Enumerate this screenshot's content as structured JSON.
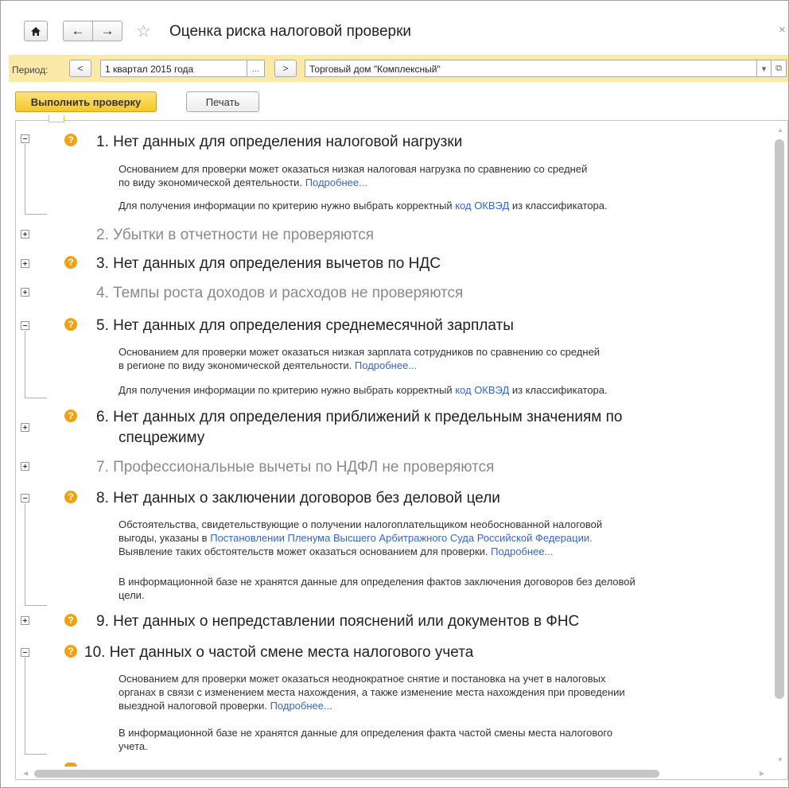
{
  "window": {
    "title": "Оценка риска налоговой проверки",
    "home_icon": "home-icon",
    "back_icon": "arrow-left-icon",
    "forward_icon": "arrow-right-icon",
    "favorite_icon": "star-icon",
    "close_icon": "close-icon",
    "close_glyph": "×"
  },
  "period_bar": {
    "label": "Период:",
    "prev": "<",
    "period_value": "1 квартал 2015 года",
    "ellipsis": "...",
    "next": ">",
    "organization": "Торговый дом \"Комплексный\"",
    "dropdown": "▾",
    "open_icon": "open-link-icon",
    "open_glyph": "⧉",
    "background": "#fbeaa7"
  },
  "actions": {
    "run_check": "Выполнить проверку",
    "print": "Печать",
    "accent": "#f4c829"
  },
  "items": {
    "i1": {
      "heading": "1. Нет данных для определения налоговой нагрузки",
      "d1": "Основанием для проверки может оказаться низкая налоговая нагрузка по сравнению со средней",
      "d2": "по виду экономической деятельности.",
      "more": "Подробнее...",
      "hint_pre": "Для получения информации по критерию нужно выбрать корректный",
      "hint_link": "код ОКВЭД",
      "hint_post": "из классификатора."
    },
    "i2": {
      "heading": "2. Убытки в отчетности не проверяются"
    },
    "i3": {
      "heading": "3. Нет данных для определения вычетов по НДС"
    },
    "i4": {
      "heading": "4. Темпы роста доходов и расходов не проверяются"
    },
    "i5": {
      "heading": "5. Нет данных для определения среднемесячной зарплаты",
      "d1": "Основанием для проверки может оказаться низкая зарплата сотрудников по сравнению со средней",
      "d2": "в регионе по виду экономической деятельности.",
      "more": "Подробнее...",
      "hint_pre": "Для получения информации по критерию нужно выбрать корректный",
      "hint_link": "код ОКВЭД",
      "hint_post": "из классификатора."
    },
    "i6": {
      "heading_l1": "6. Нет данных для определения приближений к предельным значениям по",
      "heading_l2": "спецрежиму"
    },
    "i7": {
      "heading": "7. Профессиональные вычеты по НДФЛ не проверяются"
    },
    "i8": {
      "heading": "8. Нет данных о заключении договоров без деловой цели",
      "d1": "Обстоятельства, свидетельствующие о получении налогоплательщиком необоснованной налоговой",
      "d2_pre": "выгоды, указаны в",
      "d2_link": "Постановлении Пленума Высшего Арбитражного Суда Российской Федерации.",
      "d3": "Выявление таких обстоятельств может оказаться основанием для проверки.",
      "more": "Подробнее...",
      "note1": "В информационной базе не хранятся данные для определения фактов заключения договоров без деловой",
      "note2": "цели."
    },
    "i9": {
      "heading": "9. Нет данных о непредставлении пояснений или документов в ФНС"
    },
    "i10": {
      "heading": "10. Нет данных о частой смене места налогового учета",
      "d1": "Основанием для проверки может оказаться неоднократное снятие и постановка на учет в налоговых",
      "d2": "органах в связи с изменением места нахождения, а также изменение места нахождения при проведении",
      "d3": "выездной налоговой проверки.",
      "more": "Подробнее...",
      "note1": "В информационной базе не хранятся данные для определения факта частой смены места налогового",
      "note2": "учета."
    }
  },
  "icons": {
    "question": "?",
    "question_color": "#f3a10e",
    "expand": "expand-icon",
    "collapse": "collapse-icon"
  }
}
